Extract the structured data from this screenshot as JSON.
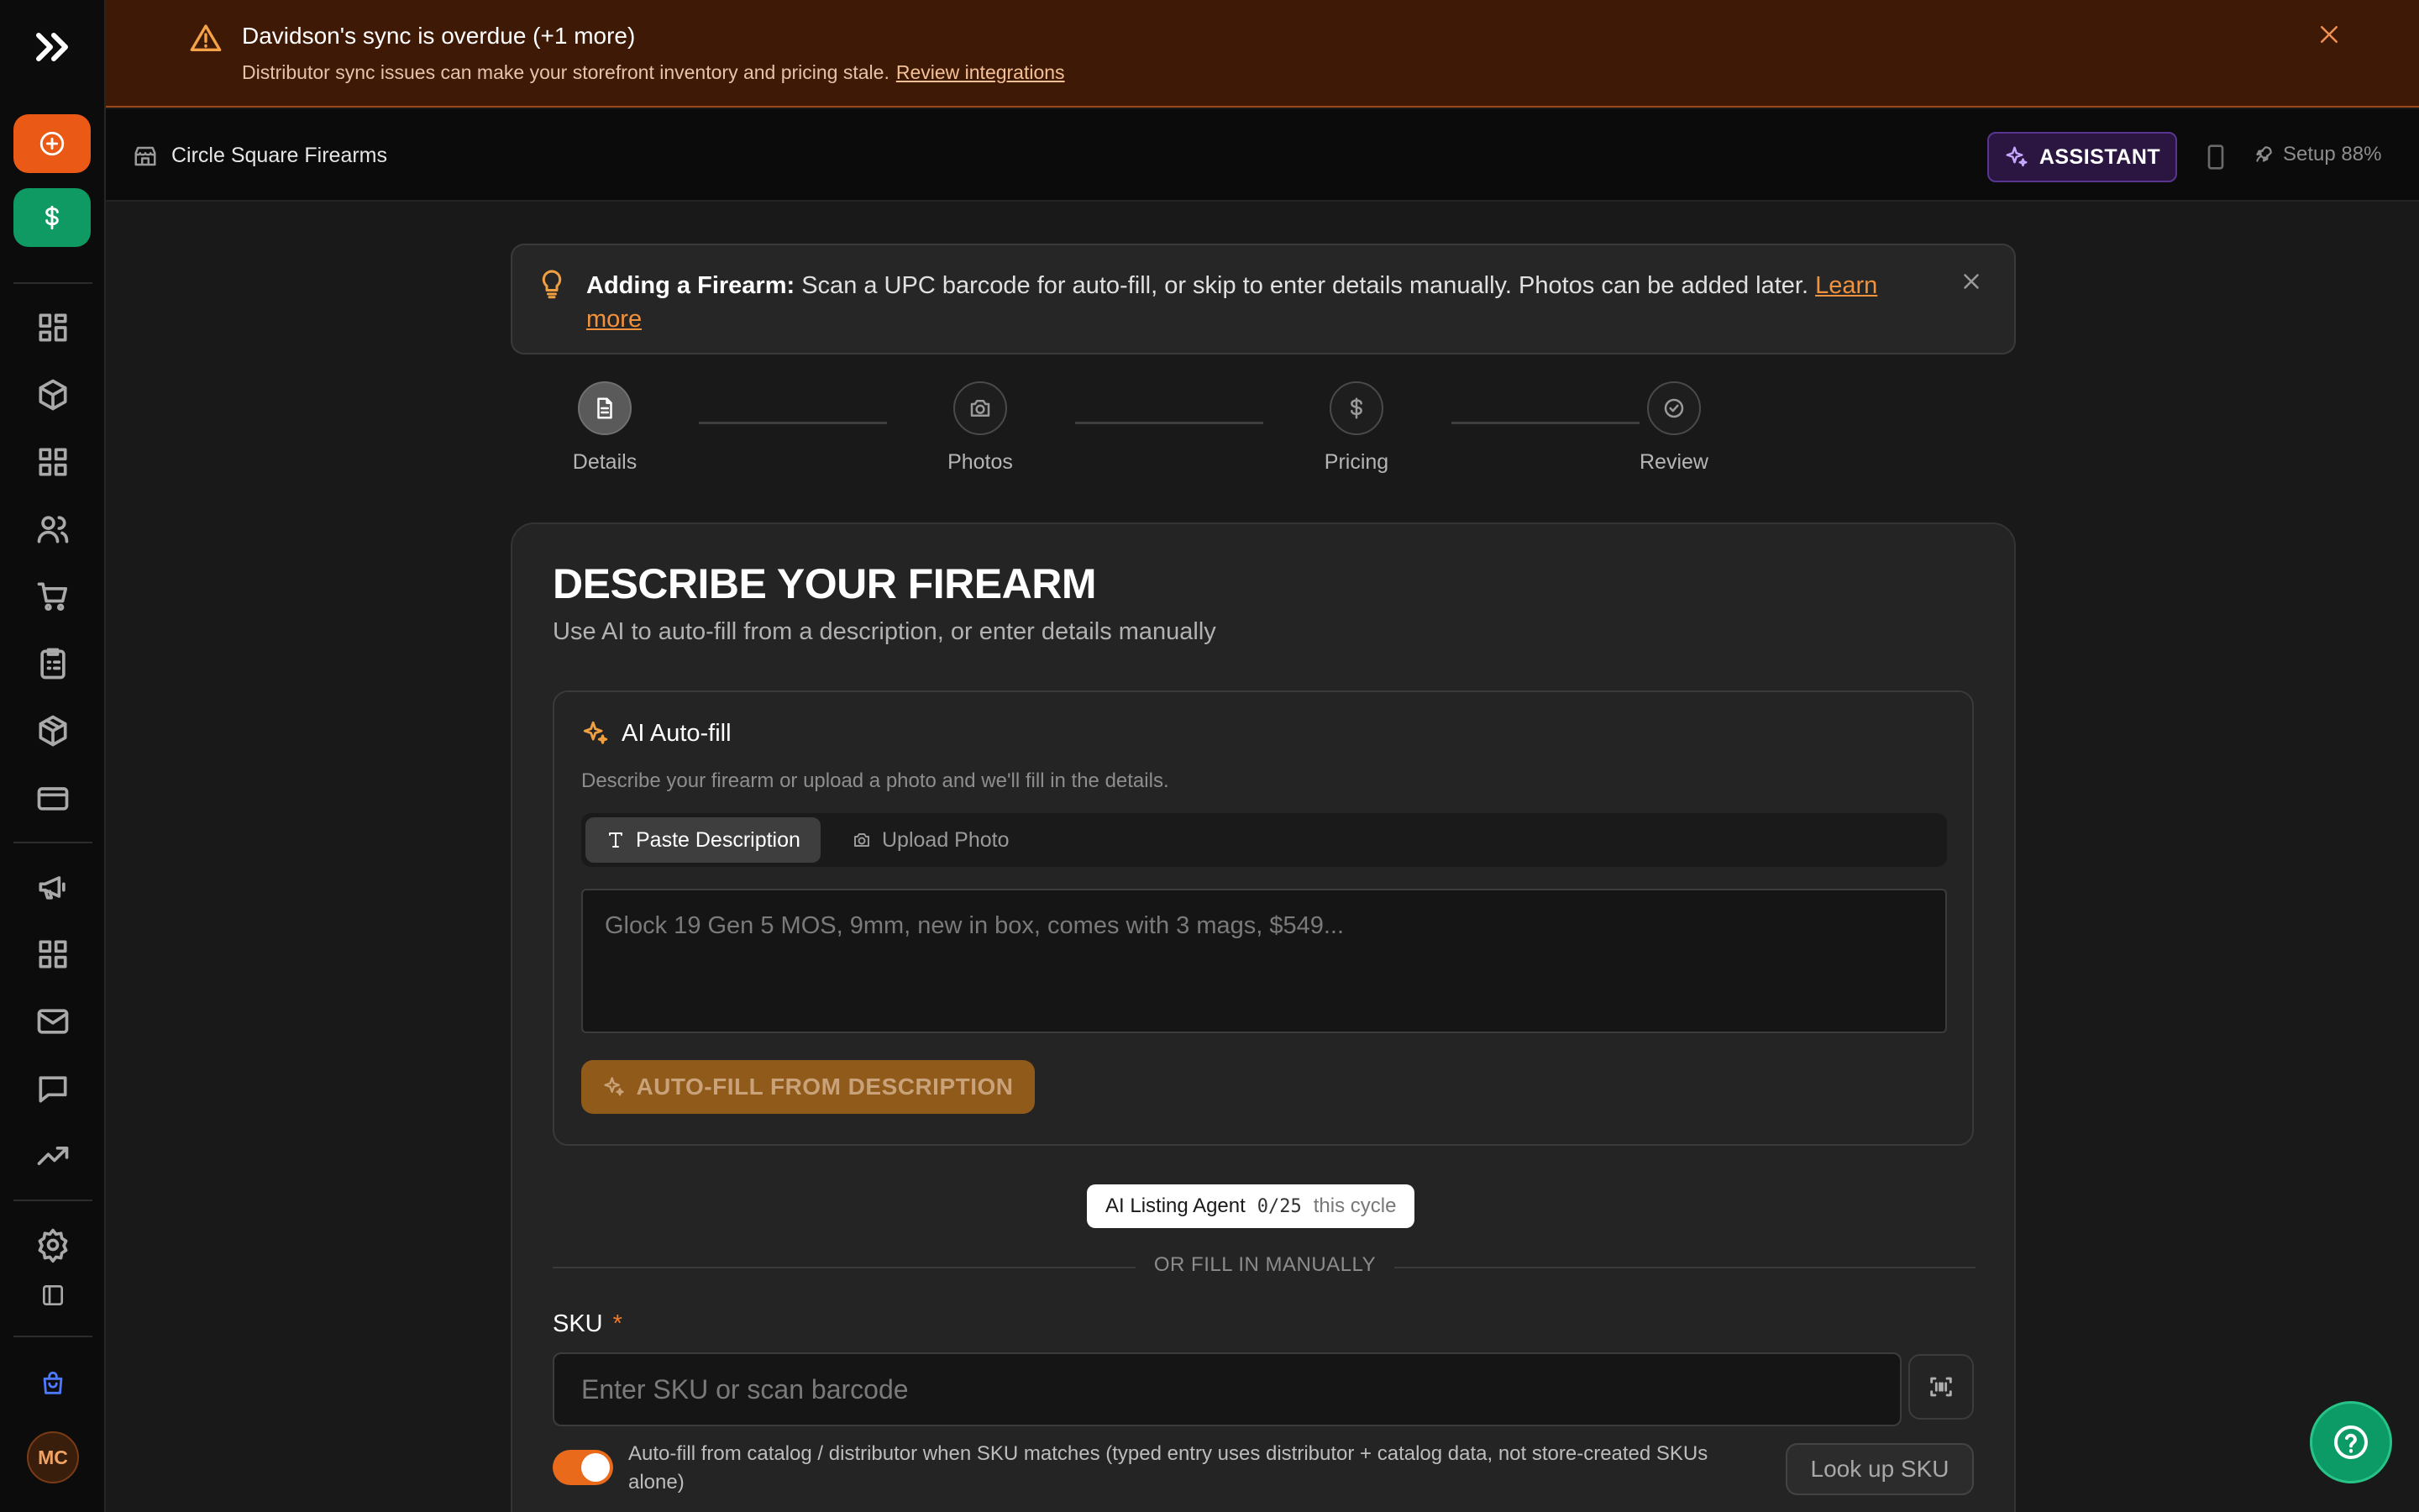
{
  "alert": {
    "title": "Davidson's sync is overdue (+1 more)",
    "message": "Distributor sync issues can make your storefront inventory and pricing stale.",
    "link": "Review integrations"
  },
  "header": {
    "store_name": "Circle Square Firearms",
    "assistant_label": "ASSISTANT",
    "setup_label": "Setup 88%"
  },
  "user": {
    "initials": "MC"
  },
  "tip": {
    "title": "Adding a Firearm:",
    "body": "Scan a UPC barcode for auto-fill, or skip to enter details manually. Photos can be added later.",
    "link": "Learn more"
  },
  "steps": [
    {
      "label": "Details",
      "active": true
    },
    {
      "label": "Photos",
      "active": false
    },
    {
      "label": "Pricing",
      "active": false
    },
    {
      "label": "Review",
      "active": false
    }
  ],
  "form": {
    "title": "DESCRIBE YOUR FIREARM",
    "subtitle": "Use AI to auto-fill from a description, or enter details manually",
    "ai": {
      "title": "AI Auto-fill",
      "description": "Describe your firearm or upload a photo and we'll fill in the details.",
      "tabs": [
        "Paste Description",
        "Upload Photo"
      ],
      "placeholder": "Glock 19 Gen 5 MOS, 9mm, new in box, comes with 3 mags, $549...",
      "button": "AUTO-FILL FROM DESCRIPTION"
    },
    "agent": {
      "name": "AI Listing Agent",
      "count": "0/25",
      "period": "this cycle"
    },
    "divider": "OR FILL IN MANUALLY",
    "sku": {
      "label": "SKU",
      "required_mark": "*",
      "placeholder": "Enter SKU or scan barcode",
      "toggle_text": "Auto-fill from catalog / distributor when SKU matches (typed entry uses distributor + catalog data, not store-created SKUs alone)",
      "toggle_on": true,
      "lookup_button": "Look up SKU"
    }
  },
  "colors": {
    "accent_orange": "#ea5a16",
    "accent_green": "#0f9a63",
    "warning_bg": "#3e1a06",
    "link_orange": "#f2923c"
  }
}
